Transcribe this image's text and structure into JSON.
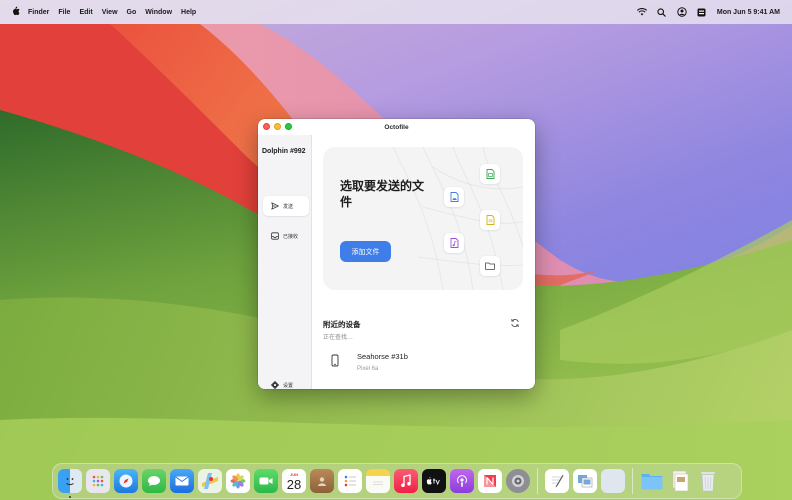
{
  "menubar": {
    "app_name": "Finder",
    "menus": [
      "File",
      "Edit",
      "View",
      "Go",
      "Window",
      "Help"
    ],
    "clock": "Mon Jun 5  9:41 AM"
  },
  "window": {
    "title": "Octofile",
    "sidebar": {
      "device_name": "Dolphin #992",
      "items": [
        {
          "label": "发送",
          "icon": "send-icon",
          "active": true
        },
        {
          "label": "已接收",
          "icon": "inbox-icon",
          "active": false
        },
        {
          "label": "设置",
          "icon": "gear-icon",
          "active": false
        }
      ]
    },
    "hero": {
      "title": "选取要发送的文件",
      "button_label": "添加文件"
    },
    "nearby": {
      "title": "附近的设备",
      "status": "正在查找…",
      "devices": [
        {
          "name": "Seahorse #31b",
          "model": "Pixel 6a"
        }
      ]
    }
  },
  "dock": {
    "calendar_month": "JUN",
    "calendar_day": "28"
  },
  "colors": {
    "accent": "#3f7ee8",
    "close": "#ff5f57",
    "minimize": "#febc2e",
    "maximize": "#28c840"
  }
}
